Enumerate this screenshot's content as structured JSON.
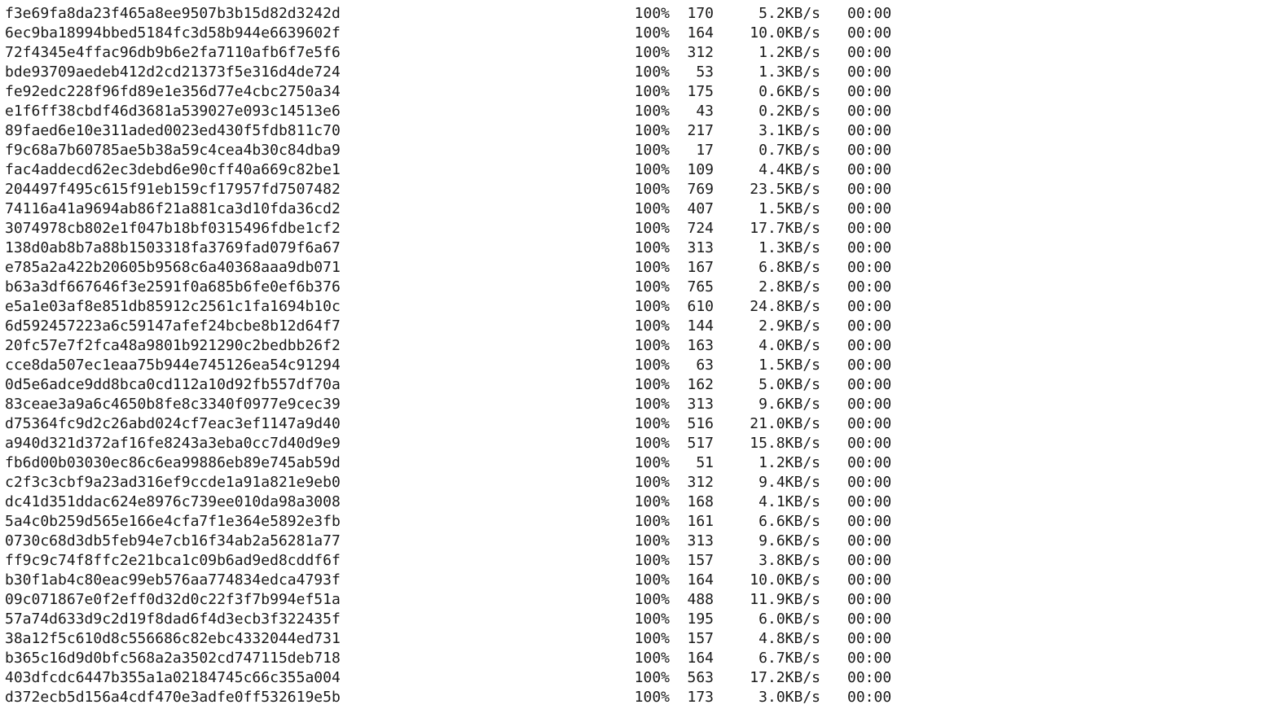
{
  "transfers": [
    {
      "name": "f3e69fa8da23f465a8ee9507b3b15d82d3242d",
      "percent": "100%",
      "size": "170",
      "speed": "5.2KB/s",
      "eta": "00:00"
    },
    {
      "name": "6ec9ba18994bbed5184fc3d58b944e6639602f",
      "percent": "100%",
      "size": "164",
      "speed": "10.0KB/s",
      "eta": "00:00"
    },
    {
      "name": "72f4345e4ffac96db9b6e2fa7110afb6f7e5f6",
      "percent": "100%",
      "size": "312",
      "speed": "1.2KB/s",
      "eta": "00:00"
    },
    {
      "name": "bde93709aedeb412d2cd21373f5e316d4de724",
      "percent": "100%",
      "size": "53",
      "speed": "1.3KB/s",
      "eta": "00:00"
    },
    {
      "name": "fe92edc228f96fd89e1e356d77e4cbc2750a34",
      "percent": "100%",
      "size": "175",
      "speed": "0.6KB/s",
      "eta": "00:00"
    },
    {
      "name": "e1f6ff38cbdf46d3681a539027e093c14513e6",
      "percent": "100%",
      "size": "43",
      "speed": "0.2KB/s",
      "eta": "00:00"
    },
    {
      "name": "89faed6e10e311aded0023ed430f5fdb811c70",
      "percent": "100%",
      "size": "217",
      "speed": "3.1KB/s",
      "eta": "00:00"
    },
    {
      "name": "f9c68a7b60785ae5b38a59c4cea4b30c84dba9",
      "percent": "100%",
      "size": "17",
      "speed": "0.7KB/s",
      "eta": "00:00"
    },
    {
      "name": "fac4addecd62ec3debd6e90cff40a669c82be1",
      "percent": "100%",
      "size": "109",
      "speed": "4.4KB/s",
      "eta": "00:00"
    },
    {
      "name": "204497f495c615f91eb159cf17957fd7507482",
      "percent": "100%",
      "size": "769",
      "speed": "23.5KB/s",
      "eta": "00:00"
    },
    {
      "name": "74116a41a9694ab86f21a881ca3d10fda36cd2",
      "percent": "100%",
      "size": "407",
      "speed": "1.5KB/s",
      "eta": "00:00"
    },
    {
      "name": "3074978cb802e1f047b18bf0315496fdbe1cf2",
      "percent": "100%",
      "size": "724",
      "speed": "17.7KB/s",
      "eta": "00:00"
    },
    {
      "name": "138d0ab8b7a88b1503318fa3769fad079f6a67",
      "percent": "100%",
      "size": "313",
      "speed": "1.3KB/s",
      "eta": "00:00"
    },
    {
      "name": "e785a2a422b20605b9568c6a40368aaa9db071",
      "percent": "100%",
      "size": "167",
      "speed": "6.8KB/s",
      "eta": "00:00"
    },
    {
      "name": "b63a3df667646f3e2591f0a685b6fe0ef6b376",
      "percent": "100%",
      "size": "765",
      "speed": "2.8KB/s",
      "eta": "00:00"
    },
    {
      "name": "e5a1e03af8e851db85912c2561c1fa1694b10c",
      "percent": "100%",
      "size": "610",
      "speed": "24.8KB/s",
      "eta": "00:00"
    },
    {
      "name": "6d592457223a6c59147afef24bcbe8b12d64f7",
      "percent": "100%",
      "size": "144",
      "speed": "2.9KB/s",
      "eta": "00:00"
    },
    {
      "name": "20fc57e7f2fca48a9801b921290c2bedbb26f2",
      "percent": "100%",
      "size": "163",
      "speed": "4.0KB/s",
      "eta": "00:00"
    },
    {
      "name": "cce8da507ec1eaa75b944e745126ea54c91294",
      "percent": "100%",
      "size": "63",
      "speed": "1.5KB/s",
      "eta": "00:00"
    },
    {
      "name": "0d5e6adce9dd8bca0cd112a10d92fb557df70a",
      "percent": "100%",
      "size": "162",
      "speed": "5.0KB/s",
      "eta": "00:00"
    },
    {
      "name": "83ceae3a9a6c4650b8fe8c3340f0977e9cec39",
      "percent": "100%",
      "size": "313",
      "speed": "9.6KB/s",
      "eta": "00:00"
    },
    {
      "name": "d75364fc9d2c26abd024cf7eac3ef1147a9d40",
      "percent": "100%",
      "size": "516",
      "speed": "21.0KB/s",
      "eta": "00:00"
    },
    {
      "name": "a940d321d372af16fe8243a3eba0cc7d40d9e9",
      "percent": "100%",
      "size": "517",
      "speed": "15.8KB/s",
      "eta": "00:00"
    },
    {
      "name": "fb6d00b03030ec86c6ea99886eb89e745ab59d",
      "percent": "100%",
      "size": "51",
      "speed": "1.2KB/s",
      "eta": "00:00"
    },
    {
      "name": "c2f3c3cbf9a23ad316ef9ccde1a91a821e9eb0",
      "percent": "100%",
      "size": "312",
      "speed": "9.4KB/s",
      "eta": "00:00"
    },
    {
      "name": "dc41d351ddac624e8976c739ee010da98a3008",
      "percent": "100%",
      "size": "168",
      "speed": "4.1KB/s",
      "eta": "00:00"
    },
    {
      "name": "5a4c0b259d565e166e4cfa7f1e364e5892e3fb",
      "percent": "100%",
      "size": "161",
      "speed": "6.6KB/s",
      "eta": "00:00"
    },
    {
      "name": "0730c68d3db5feb94e7cb16f34ab2a56281a77",
      "percent": "100%",
      "size": "313",
      "speed": "9.6KB/s",
      "eta": "00:00"
    },
    {
      "name": "ff9c9c74f8ffc2e21bca1c09b6ad9ed8cddf6f",
      "percent": "100%",
      "size": "157",
      "speed": "3.8KB/s",
      "eta": "00:00"
    },
    {
      "name": "b30f1ab4c80eac99eb576aa774834edca4793f",
      "percent": "100%",
      "size": "164",
      "speed": "10.0KB/s",
      "eta": "00:00"
    },
    {
      "name": "09c071867e0f2eff0d32d0c22f3f7b994ef51a",
      "percent": "100%",
      "size": "488",
      "speed": "11.9KB/s",
      "eta": "00:00"
    },
    {
      "name": "57a74d633d9c2d19f8dad6f4d3ecb3f322435f",
      "percent": "100%",
      "size": "195",
      "speed": "6.0KB/s",
      "eta": "00:00"
    },
    {
      "name": "38a12f5c610d8c556686c82ebc4332044ed731",
      "percent": "100%",
      "size": "157",
      "speed": "4.8KB/s",
      "eta": "00:00"
    },
    {
      "name": "b365c16d9d0bfc568a2a3502cd747115deb718",
      "percent": "100%",
      "size": "164",
      "speed": "6.7KB/s",
      "eta": "00:00"
    },
    {
      "name": "403dfcdc6447b355a1a02184745c66c355a004",
      "percent": "100%",
      "size": "563",
      "speed": "17.2KB/s",
      "eta": "00:00"
    },
    {
      "name": "d372ecb5d156a4cdf470e3adfe0ff532619e5b",
      "percent": "100%",
      "size": "173",
      "speed": "3.0KB/s",
      "eta": "00:00"
    }
  ]
}
